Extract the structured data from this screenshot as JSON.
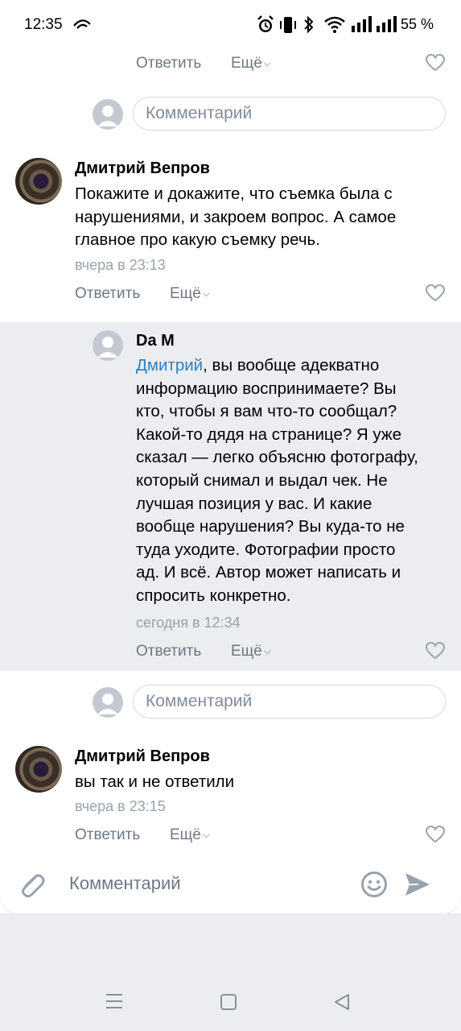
{
  "status_bar": {
    "time": "12:35",
    "battery": "55 %",
    "icons": [
      "eye-icon",
      "alarm-icon",
      "vibrate-icon",
      "bluetooth-icon",
      "wifi-icon",
      "signal-icon",
      "signal-icon-2"
    ]
  },
  "actions": {
    "reply": "Ответить",
    "more": "Ещё",
    "chevron": "⌵"
  },
  "comment_input": {
    "placeholder": "Комментарий"
  },
  "comments": [
    {
      "author": "Дмитрий Вепров",
      "lines": [
        "Покажите и докажите, что съемка была с",
        "нарушениями, и закроем вопрос. А самое",
        "главное про какую съемку речь."
      ],
      "time": "вчера в 23:13"
    },
    {
      "author": "Da M",
      "mention": "Дмитрий",
      "first_line_rest": ", вы вообще адекватно",
      "lines": [
        "информацию воспринимаете? Вы",
        "кто, чтобы я вам что-то сообщал?",
        "Какой-то дядя на странице? Я уже",
        "сказал — легко объясню фотографу,",
        "который снимал и выдал чек. Не",
        "лучшая позиция у вас. И какие",
        "вообще нарушения? Вы куда-то не",
        "туда уходите. Фотографии просто",
        "ад. И всё. Автор может написать и",
        "спросить конкретно."
      ],
      "time": "сегодня в 12:34"
    },
    {
      "author": "Дмитрий Вепров",
      "lines": [
        "вы так и не ответили"
      ],
      "time": "вчера в 23:15"
    }
  ],
  "bottom_bar": {
    "placeholder": "Комментарий"
  },
  "colors": {
    "accent": "#2a7fc4",
    "secondary_text": "#6d7885",
    "time_text": "#99a2ad",
    "reply_bg": "#ebedf0"
  }
}
